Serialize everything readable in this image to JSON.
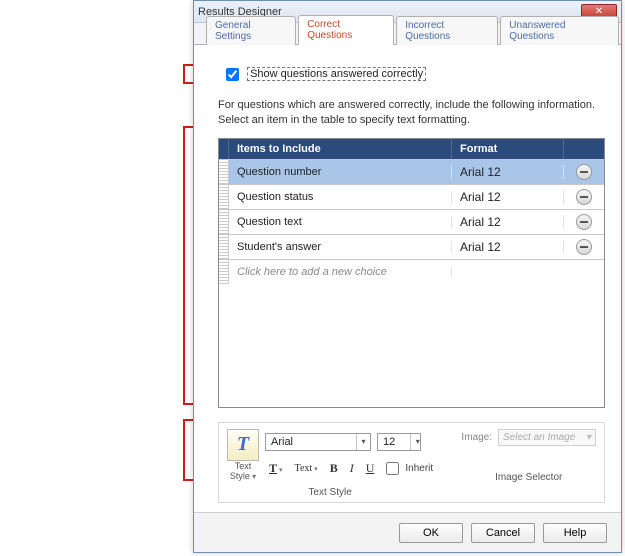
{
  "title": "Results Designer",
  "tabs": [
    {
      "label": "General Settings"
    },
    {
      "label": "Correct Questions"
    },
    {
      "label": "Incorrect Questions"
    },
    {
      "label": "Unanswered Questions"
    }
  ],
  "active_tab": 1,
  "checkbox_label": "Show questions answered correctly",
  "checkbox_checked": true,
  "description": "For questions which are answered correctly, include the following information. Select an item in the table to specify text formatting.",
  "columns": {
    "items": "Items to Include",
    "format": "Format"
  },
  "rows": [
    {
      "item": "Question number",
      "format": "Arial 12",
      "selected": true
    },
    {
      "item": "Question status",
      "format": "Arial 12",
      "selected": false
    },
    {
      "item": "Question text",
      "format": "Arial 12",
      "selected": false
    },
    {
      "item": "Student's answer",
      "format": "Arial 12",
      "selected": false
    }
  ],
  "add_row_text": "Click here to add a new choice",
  "toolbar": {
    "text_style_label": "Text\nStyle",
    "font_name": "Arial",
    "font_size": "12",
    "t_label": "T",
    "text_label": "Text",
    "bold": "B",
    "italic": "I",
    "underline": "U",
    "inherit": "Inherit",
    "group_text": "Text Style",
    "image_label": "Image:",
    "image_placeholder": "Select an Image",
    "group_image": "Image Selector"
  },
  "buttons": {
    "ok": "OK",
    "cancel": "Cancel",
    "help": "Help"
  }
}
